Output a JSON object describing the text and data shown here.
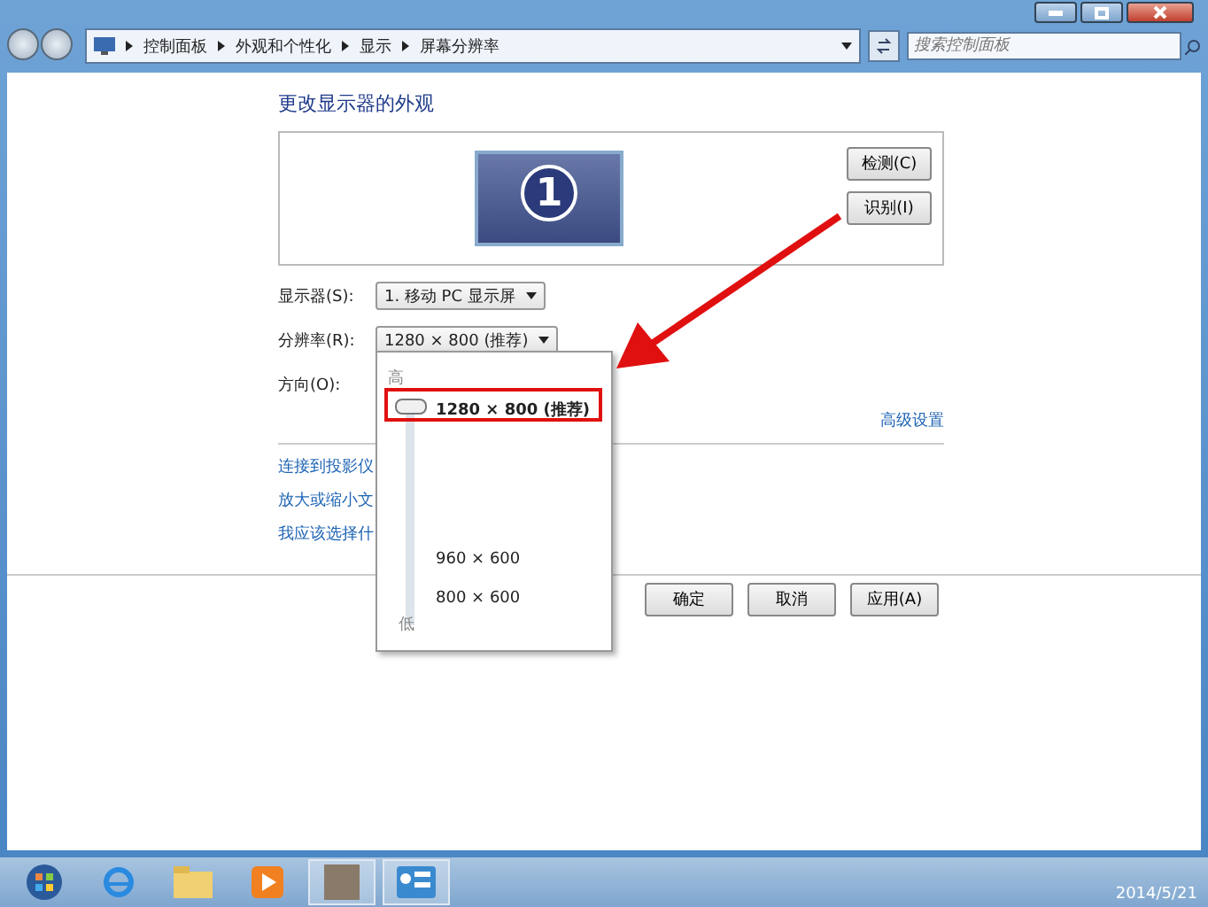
{
  "address_bar": {
    "crumbs": [
      "控制面板",
      "外观和个性化",
      "显示",
      "屏幕分辨率"
    ],
    "search": {
      "placeholder": "搜索控制面板"
    }
  },
  "heading": "更改显示器的外观",
  "monitor": {
    "number": "1"
  },
  "side_buttons": [
    "检测(C)",
    "识别(I)"
  ],
  "fields": [
    {
      "label": "显示器(S):",
      "value": "1. 移动 PC 显示屏"
    },
    {
      "label": "分辨率(R):",
      "value": "1280 × 800 (推荐)"
    },
    {
      "label": "方向(O):"
    }
  ],
  "advanced_link": "高级设置",
  "links": [
    "连接到投影仪",
    "放大或缩小文",
    "我应该选择什"
  ],
  "buttons": [
    "确定",
    "取消",
    "应用(A)"
  ],
  "resolution_popup": {
    "high_label": "高",
    "low_label": "低",
    "level": 1,
    "options": [
      {
        "label": "1280 × 800 (推荐)",
        "selected": true
      },
      {
        "label": "960 × 600",
        "selected": false
      },
      {
        "label": "800 × 600",
        "selected": false
      }
    ]
  },
  "taskbar": {
    "date": "2014/5/21"
  }
}
